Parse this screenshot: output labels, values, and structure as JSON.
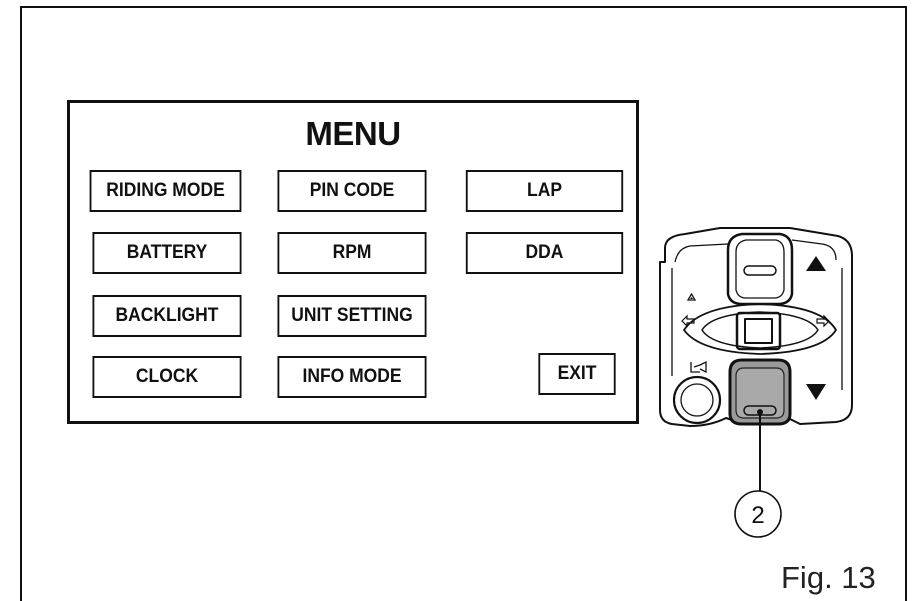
{
  "menu": {
    "title": "MENU",
    "buttons": {
      "riding_mode": "RIDING MODE",
      "pin_code": "PIN CODE",
      "lap": "LAP",
      "battery": "BATTERY",
      "rpm": "RPM",
      "dda": "DDA",
      "backlight": "BACKLIGHT",
      "unit_setting": "UNIT SETTING",
      "clock": "CLOCK",
      "info_mode": "INFO MODE",
      "exit": "EXIT"
    }
  },
  "callout": {
    "number": "2"
  },
  "figure": {
    "caption": "Fig. 13"
  },
  "icons": [
    "up-arrow-icon",
    "down-arrow-icon",
    "left-turn-arrow-icon",
    "right-turn-arrow-icon",
    "hazard-triangle-icon",
    "horn-icon"
  ],
  "colors": {
    "ink": "#111111",
    "highlighted_button": "#9a9a9a"
  }
}
